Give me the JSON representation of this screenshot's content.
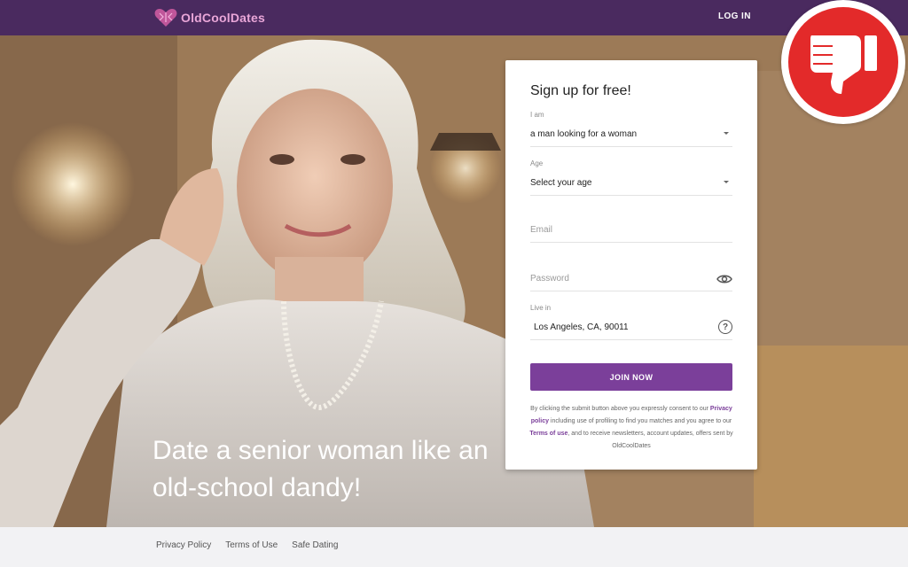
{
  "header": {
    "logo_text": "OldCoolDates",
    "login_label": "LOG IN"
  },
  "hero": {
    "headline": "Date a senior woman like an old-school dandy!"
  },
  "signup": {
    "title": "Sign up for free!",
    "iam_label": "I am",
    "iam_value": "a man looking for a woman",
    "age_label": "Age",
    "age_value": "Select your age",
    "email_placeholder": "Email",
    "password_placeholder": "Password",
    "live_label": "Live in",
    "live_value": "Los Angeles, CA, 90011",
    "join_label": "JOIN NOW",
    "legal_part1": "By clicking the submit button above you expressly consent to our ",
    "privacy_link": "Privacy policy",
    "legal_part2": " including use of profiling to find you matches and you agree to our ",
    "terms_link": "Terms of use",
    "legal_part3": ", and to receive newsletters, account updates, offers sent by OldCoolDates"
  },
  "footer": {
    "links": [
      "Privacy Policy",
      "Terms of Use",
      "Safe Dating"
    ]
  },
  "colors": {
    "header_bg": "#4a2a5f",
    "accent": "#7b3f9a",
    "badge_red": "#e32a2a"
  },
  "icons": [
    "heart-logo-icon",
    "chevron-down-icon",
    "eye-icon",
    "question-icon",
    "thumbs-down-icon"
  ]
}
